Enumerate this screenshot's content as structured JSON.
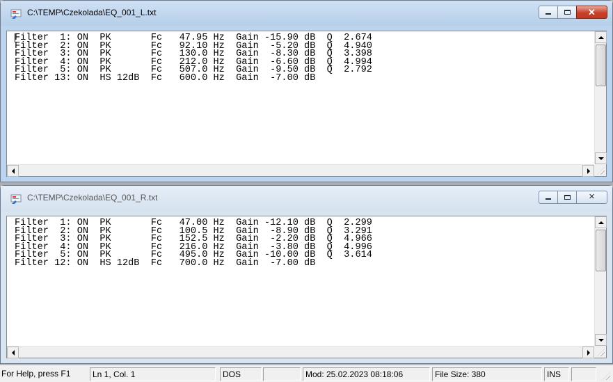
{
  "windows": [
    {
      "title": "C:\\TEMP\\Czekolada\\EQ_001_L.txt",
      "active": true,
      "lines": [
        "Filter  1: ON  PK       Fc   47.95 Hz  Gain -15.90 dB  Q  2.674",
        "Filter  2: ON  PK       Fc   92.10 Hz  Gain  -5.20 dB  Q  4.940",
        "Filter  3: ON  PK       Fc   130.0 Hz  Gain  -8.30 dB  Q  3.398",
        "Filter  4: ON  PK       Fc   212.0 Hz  Gain  -6.60 dB  Q  4.994",
        "Filter  5: ON  PK       Fc   507.0 Hz  Gain  -9.50 dB  Q  2.792",
        "Filter 13: ON  HS 12dB  Fc   600.0 Hz  Gain  -7.00 dB"
      ]
    },
    {
      "title": "C:\\TEMP\\Czekolada\\EQ_001_R.txt",
      "active": false,
      "lines": [
        "Filter  1: ON  PK       Fc   47.00 Hz  Gain -12.10 dB  Q  2.299",
        "Filter  2: ON  PK       Fc   100.5 Hz  Gain  -8.90 dB  Q  3.291",
        "Filter  3: ON  PK       Fc   152.5 Hz  Gain  -2.20 dB  Q  4.966",
        "Filter  4: ON  PK       Fc   216.0 Hz  Gain  -3.80 dB  Q  4.996",
        "Filter  5: ON  PK       Fc   495.0 Hz  Gain -10.00 dB  Q  3.614",
        "Filter 12: ON  HS 12dB  Fc   700.0 Hz  Gain  -7.00 dB"
      ]
    }
  ],
  "caption_buttons": {
    "minimize": "minimize-icon",
    "maximize": "maximize-icon",
    "close": "close-icon"
  },
  "statusbar": {
    "help": "For Help, press F1",
    "position": "Ln 1, Col. 1",
    "format": "DOS",
    "modified": "Mod: 25.02.2023 08:18:06",
    "file_size": "File Size: 380",
    "mode": "INS"
  }
}
